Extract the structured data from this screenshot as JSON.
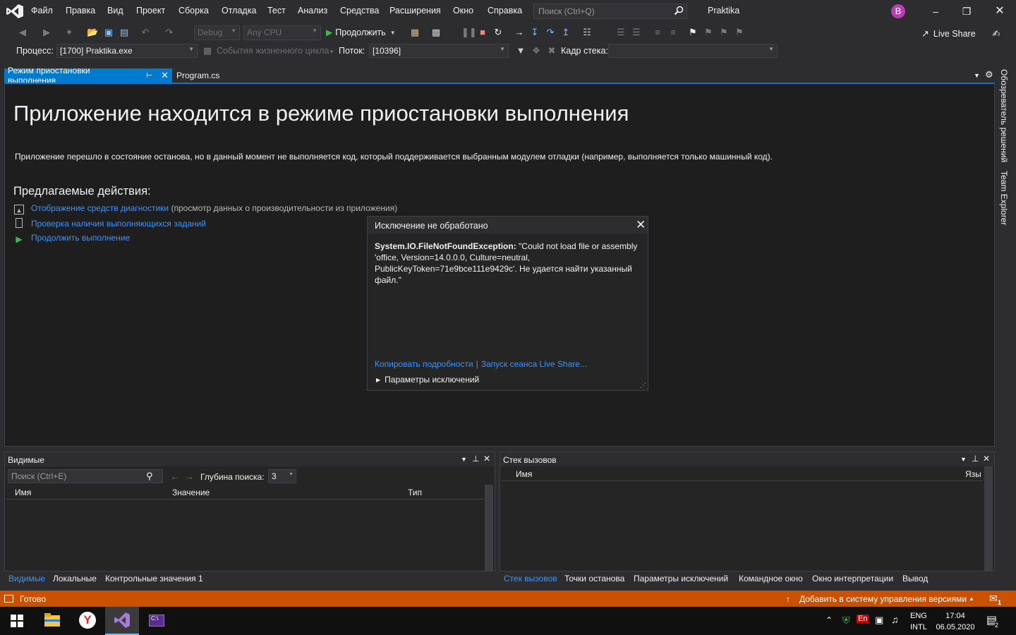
{
  "menubar": {
    "items": [
      "Файл",
      "Правка",
      "Вид",
      "Проект",
      "Сборка",
      "Отладка",
      "Тест",
      "Анализ",
      "Средства",
      "Расширения",
      "Окно",
      "Справка"
    ],
    "search_placeholder": "Поиск (Ctrl+Q)",
    "solution_name": "Praktika",
    "avatar_letter": "B"
  },
  "toolbar": {
    "config": "Debug",
    "platform": "Any CPU",
    "continue_label": "Продолжить",
    "live_share_label": "Live Share"
  },
  "debugbar": {
    "process_label": "Процесс:",
    "process_value": "[1700] Praktika.exe",
    "lifecycle_label": "События жизненного цикла",
    "thread_label": "Поток:",
    "thread_value": "[10396]",
    "stack_frame_label": "Кадр стека:"
  },
  "tabs": {
    "break_mode": "Режим приостановки выполнения",
    "program": "Program.cs"
  },
  "breakmode": {
    "title": "Приложение находится в режиме приостановки выполнения",
    "description": "Приложение перешло в состояние останова, но в данный момент не выполняется код, который поддерживается выбранным модулем отладки (например, выполняется только машинный код).",
    "actions_heading": "Предлагаемые действия:",
    "actions": [
      {
        "link": "Отображение средств диагностики",
        "note": "(просмотр данных о производительности из приложения)"
      },
      {
        "link": "Проверка наличия выполняющихся заданий",
        "note": ""
      },
      {
        "link": "Продолжить выполнение",
        "note": ""
      }
    ]
  },
  "exception": {
    "title": "Исключение не обработано",
    "type": "System.IO.FileNotFoundException:",
    "message": " \"Could not load file or assembly 'office, Version=14.0.0.0, Culture=neutral, PublicKeyToken=71e9bce111e9429c'. Не удается найти указанный файл.\"",
    "copy_details": "Копировать подробности",
    "live_share": "Запуск сеанса Live Share...",
    "params": "Параметры исключений"
  },
  "side_strip": {
    "solution_explorer": "Обозреватель решений",
    "team_explorer": "Team Explorer"
  },
  "autos_panel": {
    "title": "Видимые",
    "search_placeholder": "Поиск (Ctrl+E)",
    "depth_label": "Глубина поиска:",
    "depth_value": "3",
    "col_name": "Имя",
    "col_value": "Значение",
    "col_type": "Тип",
    "tabs": [
      "Видимые",
      "Локальные",
      "Контрольные значения 1"
    ]
  },
  "callstack_panel": {
    "title": "Стек вызовов",
    "col_name": "Имя",
    "col_lang": "Язык",
    "tabs": [
      "Стек вызовов",
      "Точки останова",
      "Параметры исключений",
      "Командное окно",
      "Окно интерпретации",
      "Вывод"
    ]
  },
  "statusbar": {
    "ready": "Готово",
    "vcs": "Добавить в систему управления версиями",
    "notifications": "1"
  },
  "taskbar": {
    "lang_top": "ENG",
    "lang_bottom": "INTL",
    "time": "17:04",
    "date": "06.05.2020",
    "ime": "En",
    "notif_count": "2"
  }
}
